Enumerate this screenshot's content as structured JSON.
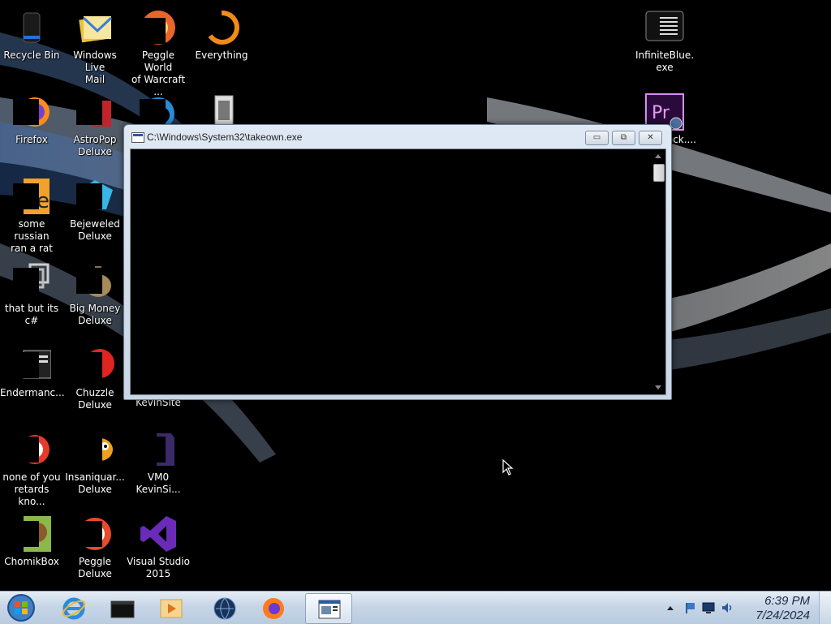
{
  "desktop": {
    "icons": [
      {
        "name": "recycle-bin",
        "label": "Recycle Bin"
      },
      {
        "name": "windows-live-mail",
        "label": "Windows Live\nMail"
      },
      {
        "name": "peggle-world-of-warcraft",
        "label": "Peggle World\nof Warcraft ..."
      },
      {
        "name": "everything",
        "label": "Everything"
      },
      {
        "name": "infiniteblue-exe",
        "label": "InfiniteBlue.exe"
      },
      {
        "name": "premiere",
        "label": "...uck...."
      },
      {
        "name": "firefox",
        "label": "Firefox"
      },
      {
        "name": "astropop-deluxe",
        "label": "AstroPop\nDeluxe"
      },
      {
        "name": "some-russian-ran-a-rat",
        "label": "some russian\nran a rat"
      },
      {
        "name": "bejeweled-deluxe",
        "label": "Bejeweled\nDeluxe"
      },
      {
        "name": "that-but-its-csharp",
        "label": "that but its c#"
      },
      {
        "name": "big-money-deluxe",
        "label": "Big Money\nDeluxe"
      },
      {
        "name": "endermanc",
        "label": "Endermanc..."
      },
      {
        "name": "chuzzle-deluxe",
        "label": "Chuzzle\nDeluxe"
      },
      {
        "name": "kevinsite",
        "label": "KevinSite"
      },
      {
        "name": "none-of-you",
        "label": "none of you\nretards kno..."
      },
      {
        "name": "insaniquarium-deluxe",
        "label": "Insaniquar...\nDeluxe"
      },
      {
        "name": "vm0-kevinsite",
        "label": "VM0\nKevinSi..."
      },
      {
        "name": "chomikbox",
        "label": "ChomikBox"
      },
      {
        "name": "peggle-deluxe",
        "label": "Peggle Deluxe"
      },
      {
        "name": "visual-studio-2015",
        "label": "Visual Studio\n2015"
      }
    ]
  },
  "console_window": {
    "title": "C:\\Windows\\System32\\takeown.exe",
    "minimize_glyph": "▭",
    "maximize_glyph": "⧉",
    "close_glyph": "✕"
  },
  "taskbar": {
    "items": [
      {
        "name": "internet-explorer"
      },
      {
        "name": "cmd-window"
      },
      {
        "name": "media-player"
      },
      {
        "name": "globe-app"
      },
      {
        "name": "firefox"
      },
      {
        "name": "takeown-console"
      }
    ],
    "clock": {
      "time": "6:39 PM",
      "date": "7/24/2024"
    }
  },
  "colors": {
    "desktop_bg": "#000000",
    "taskbar_bg": "#c7d6e7",
    "console_bg": "#000000"
  }
}
